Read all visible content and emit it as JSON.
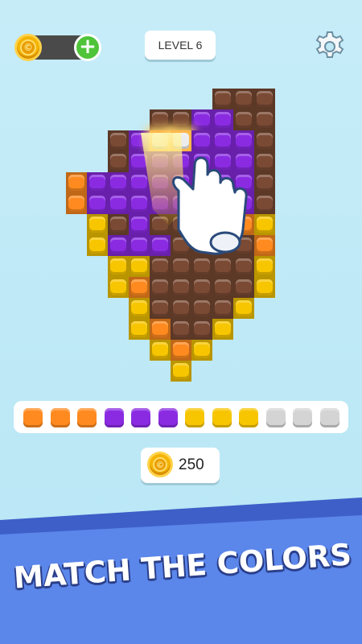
{
  "header": {
    "level_label": "LEVEL 6",
    "add_coins_symbol": "+",
    "coin_symbol": "©"
  },
  "coins": {
    "count": "250"
  },
  "banner": {
    "text": "MATCH THE COLORS"
  },
  "colors": {
    "brown": "#7a4a34",
    "purple": "#8a2be2",
    "yellow": "#f7c600",
    "orange": "#ff8a1f",
    "white": "#ececec",
    "gray": "#d4d4d4",
    "banner_blue": "#5b86ea"
  },
  "queue_slots": [
    "orange",
    "orange",
    "orange",
    "purple",
    "purple",
    "purple",
    "yellow",
    "yellow",
    "yellow",
    "gray",
    "gray",
    "gray"
  ],
  "board": {
    "rows": [
      "...BBB...",
      "..BBPPBB.",
      ".BPWWPPPB",
      ".BPPPPPPB",
      "OPPPPPPPPB",
      "OPPPPPPPPB",
      "YBPBBBBOY",
      "YPPPBBBBO",
      "YYBBBBBY",
      "YOBBBBBY",
      "YBBBBY",
      "YOBBY",
      "YOY",
      "Y"
    ]
  }
}
